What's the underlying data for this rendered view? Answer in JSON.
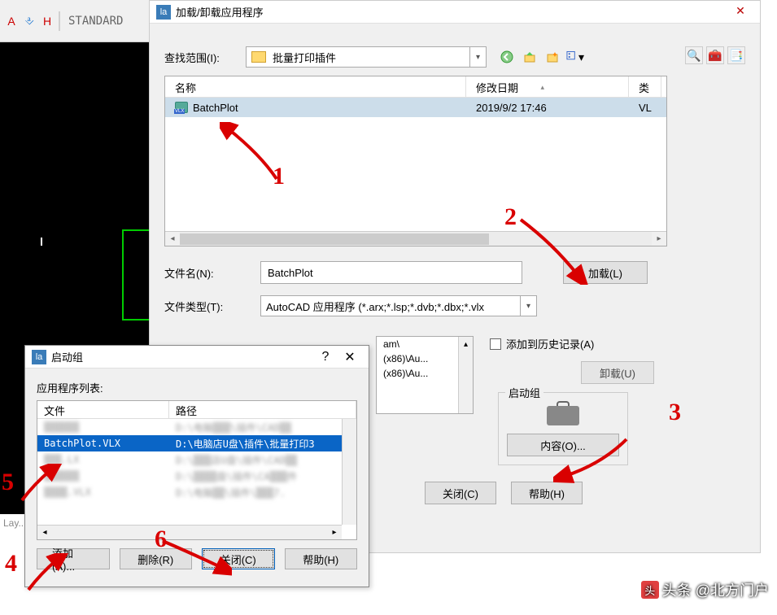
{
  "background": {
    "standard_label": "STANDARD",
    "layout_tab": "Lay..."
  },
  "main_dialog": {
    "title": "加载/卸载应用程序",
    "lookin_label": "查找范围(I):",
    "folder_name": "批量打印插件",
    "columns": {
      "name": "名称",
      "date": "修改日期",
      "type": "类"
    },
    "file": {
      "name": "BatchPlot",
      "date": "2019/9/2 17:46",
      "type": "VL"
    },
    "filename_label": "文件名(N):",
    "filename_value": "BatchPlot",
    "filetype_label": "文件类型(T):",
    "filetype_value": "AutoCAD 应用程序 (*.arx;*.lsp;*.dvb;*.dbx;*.vlx",
    "load_btn": "加载(L)",
    "add_history": "添加到历史记录(A)",
    "unload_btn": "卸载(U)",
    "startup_group": "启动组",
    "content_btn": "内容(O)...",
    "close_btn": "关闭(C)",
    "help_btn": "帮助(H)",
    "loaded_apps": [
      "am\\",
      " (x86)\\Au...",
      " (x86)\\Au..."
    ]
  },
  "startup_dialog": {
    "title": "启动组",
    "list_label": "应用程序列表:",
    "cols": {
      "file": "文件",
      "path": "路径"
    },
    "rows": [
      {
        "file": "▒▒▒▒▒▒",
        "path": "D:\\电脑▒▒▒\\插件\\CAD▒▒",
        "blur": true
      },
      {
        "file": "BatchPlot.VLX",
        "path": "D:\\电脑店U盘\\插件\\批量打印3",
        "blur": false,
        "sel": true
      },
      {
        "file": "▒▒▒.LX",
        "path": "D:\\▒▒▒店U盘\\插件\\CAD▒▒",
        "blur": true
      },
      {
        "file": "▒▒▒▒▒▒",
        "path": "D:\\▒▒▒▒盘\\插件\\CA▒▒▒件",
        "blur": true
      },
      {
        "file": "▒▒▒▒.VLX",
        "path": "D:\\电脑▒▒\\插件\\▒▒▒7.",
        "blur": true
      }
    ],
    "add_btn": "添加(A)...",
    "remove_btn": "删除(R)",
    "close_btn": "关闭(C)",
    "help_btn": "帮助(H)"
  },
  "annotations": {
    "n1": "1",
    "n2": "2",
    "n3": "3",
    "n4": "4",
    "n5": "5",
    "n6": "6"
  },
  "watermark": "头条 @北方门户"
}
